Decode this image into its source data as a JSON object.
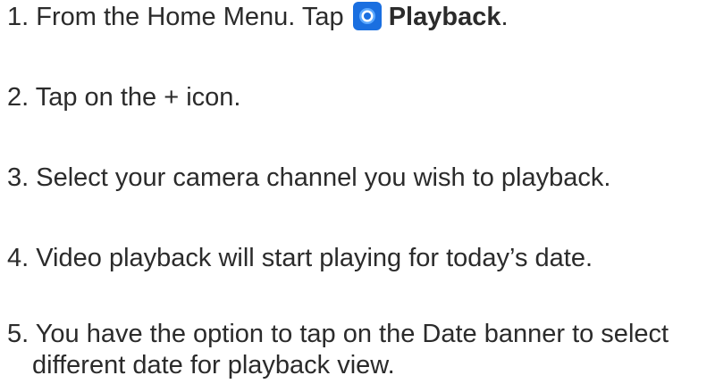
{
  "steps": [
    {
      "text_before": "1. From the Home Menu. Tap ",
      "icon": "playback-app-icon",
      "bold_text": "Playback",
      "text_after": "."
    },
    {
      "text": "2. Tap on the + icon."
    },
    {
      "text": "3. Select your camera channel you wish to playback."
    },
    {
      "text": "4. Video playback will start playing for today’s date."
    },
    {
      "text": "5. You have the option to tap on the Date banner to select different date for playback view."
    }
  ],
  "colors": {
    "text": "#2b2b2b",
    "icon_accent": "#1a6fe0"
  }
}
